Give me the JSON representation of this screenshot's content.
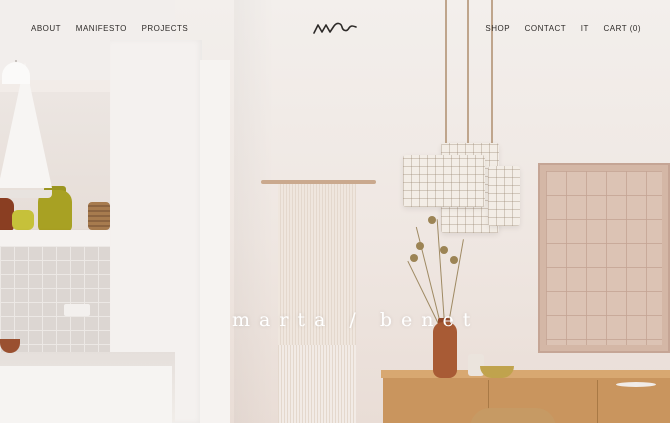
{
  "nav_left": [
    {
      "label": "ABOUT"
    },
    {
      "label": "MANIFESTO"
    },
    {
      "label": "PROJECTS"
    }
  ],
  "nav_right": [
    {
      "label": "SHOP"
    },
    {
      "label": "CONTACT"
    },
    {
      "label": "IT"
    },
    {
      "label": "CART (0)"
    }
  ],
  "logo": {
    "icon": "ms-signature-logo"
  },
  "hero": {
    "brand_text": "marta / benet"
  },
  "colors": {
    "text_dark": "#2d2a28",
    "brand_white": "#ffffff",
    "wall": "#efe9e4"
  }
}
